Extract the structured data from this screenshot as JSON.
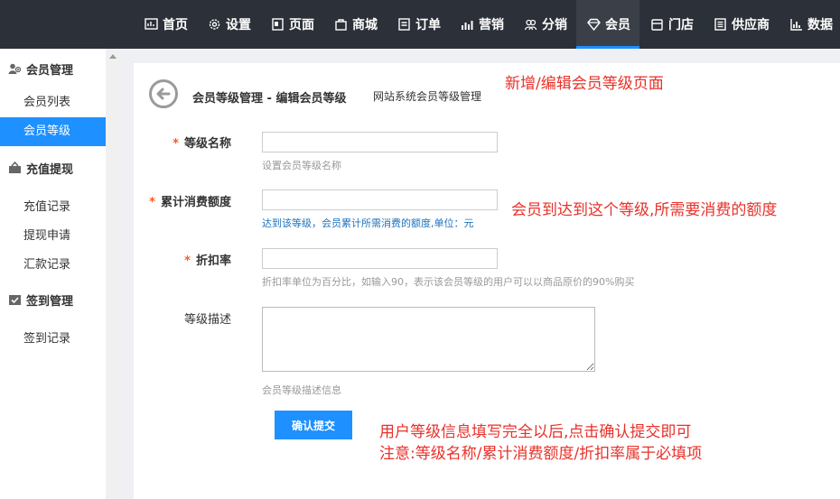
{
  "nav": {
    "items": [
      {
        "label": "首页",
        "icon": "chart-icon"
      },
      {
        "label": "设置",
        "icon": "gear-icon"
      },
      {
        "label": "页面",
        "icon": "page-icon"
      },
      {
        "label": "商城",
        "icon": "bag-icon"
      },
      {
        "label": "订单",
        "icon": "list-icon"
      },
      {
        "label": "营销",
        "icon": "bar-chart-icon"
      },
      {
        "label": "分销",
        "icon": "users-icon"
      },
      {
        "label": "会员",
        "icon": "diamond-icon",
        "active": true
      },
      {
        "label": "门店",
        "icon": "store-icon"
      },
      {
        "label": "供应商",
        "icon": "doc-icon"
      },
      {
        "label": "数据",
        "icon": "stats-icon"
      }
    ],
    "active_color": "#1e90ff"
  },
  "sidebar": {
    "groups": [
      {
        "label": "会员管理",
        "items": [
          "会员列表",
          "会员等级"
        ]
      },
      {
        "label": "充值提现",
        "items": [
          "充值记录",
          "提现申请",
          "汇款记录"
        ]
      },
      {
        "label": "签到管理",
        "items": [
          "签到记录"
        ]
      }
    ],
    "active_item": "会员等级"
  },
  "page": {
    "title": "会员等级管理 - 编辑会员等级",
    "subtitle": "网站系统会员等级管理"
  },
  "form": {
    "level_name": {
      "label": "等级名称",
      "value": "",
      "hint": "设置会员等级名称"
    },
    "total_spend": {
      "label": "累计消费额度",
      "value": "",
      "hint": "达到该等级，会员累计所需消费的额度,单位：元"
    },
    "discount": {
      "label": "折扣率",
      "value": "",
      "hint": "折扣率单位为百分比，如输入90，表示该会员等级的用户可以以商品原价的90%购买"
    },
    "description": {
      "label": "等级描述",
      "value": "",
      "hint": "会员等级描述信息"
    },
    "submit_label": "确认提交",
    "required_mark": "*"
  },
  "annotations": {
    "top": "新增/编辑会员等级页面",
    "spend": "会员到达到这个等级,所需要消费的额度",
    "bottom_line1": "用户等级信息填写完全以后,点击确认提交即可",
    "bottom_line2": "注意:等级名称/累计消费额度/折扣率属于必填项"
  }
}
